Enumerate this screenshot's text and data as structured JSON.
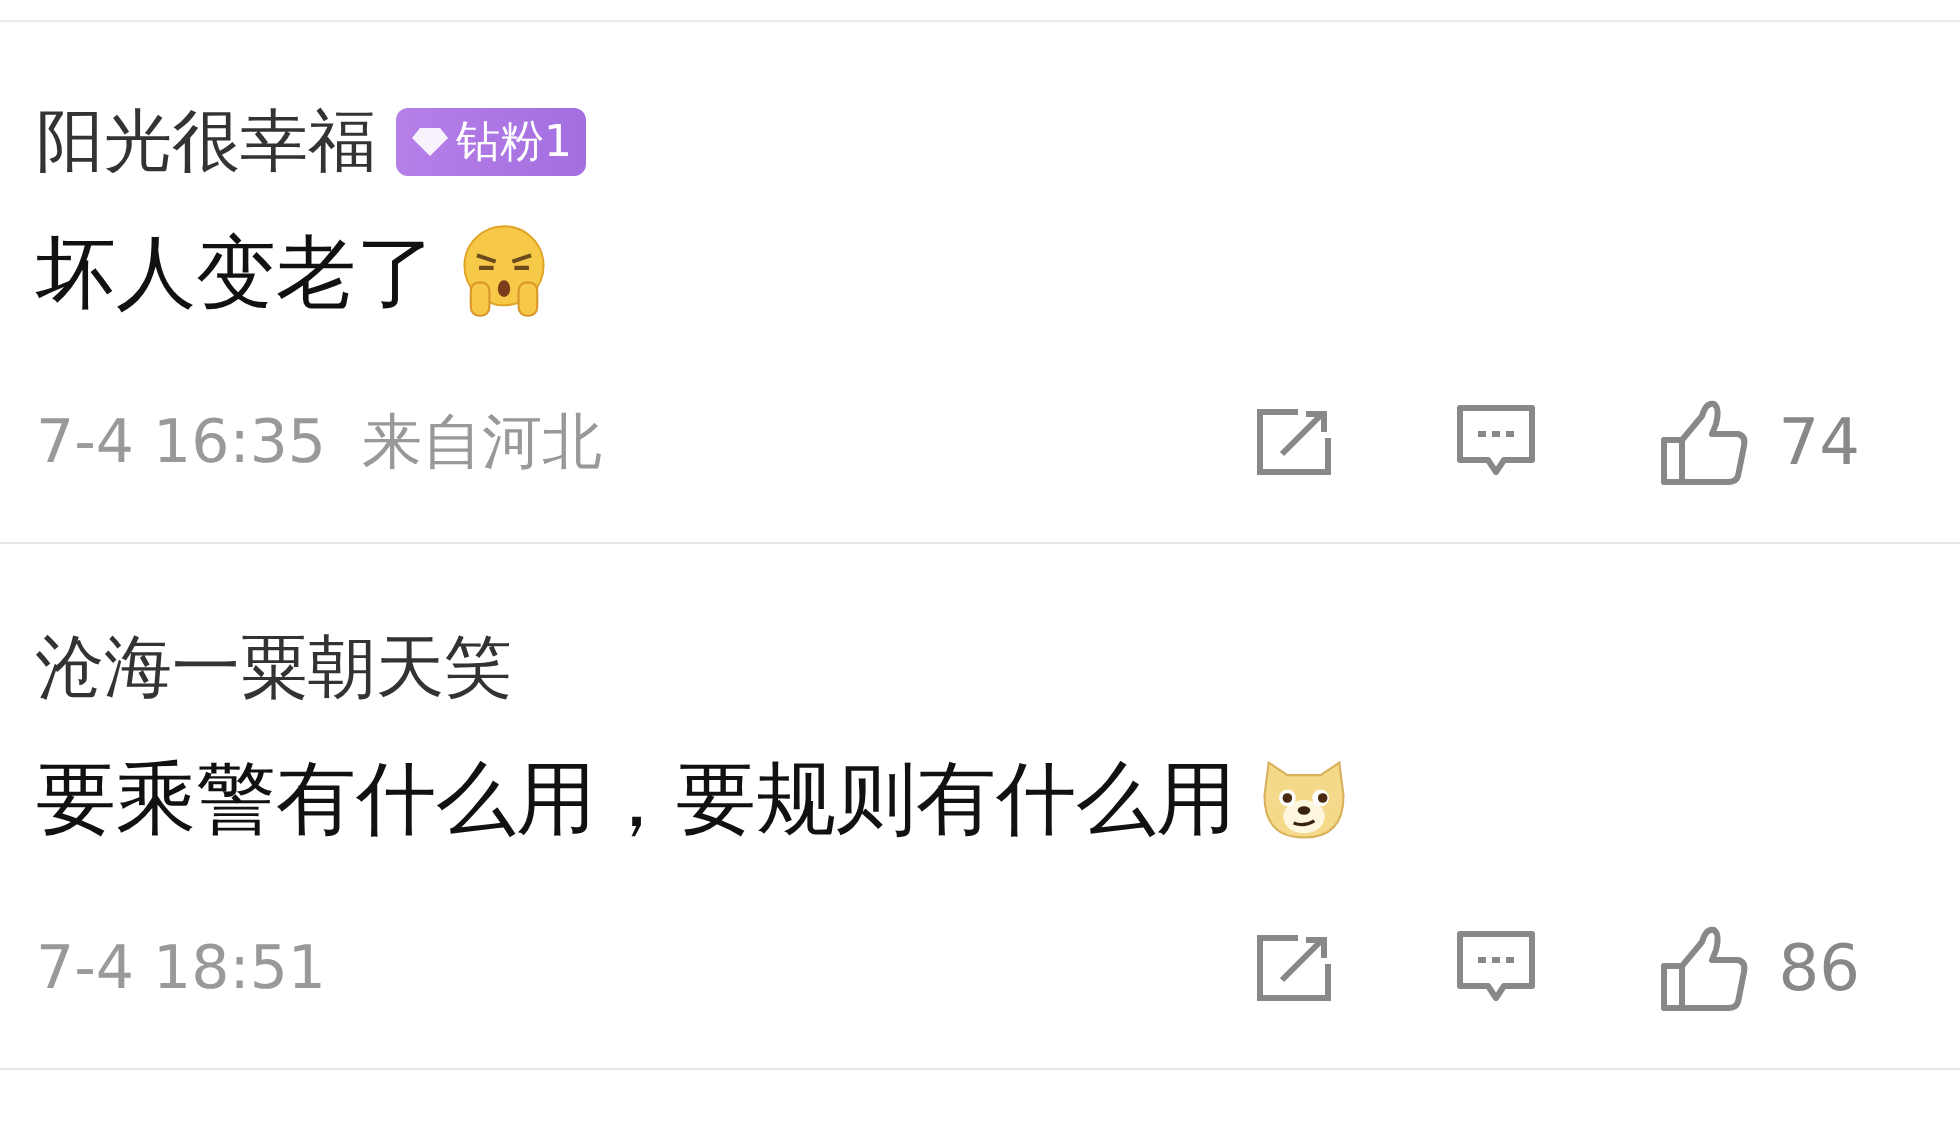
{
  "comments": [
    {
      "user": "阳光很幸福",
      "badge": "钻粉1",
      "text": "坏人变老了",
      "emoji": {
        "kind": "grumpy"
      },
      "time": "7-4 16:35",
      "location": "来自河北",
      "likes": "74"
    },
    {
      "user": "沧海一粟朝天笑",
      "text": "要乘警有什么用，要规则有什么用",
      "emoji": {
        "kind": "dog"
      },
      "time": "7-4 18:51",
      "likes": "86"
    }
  ]
}
